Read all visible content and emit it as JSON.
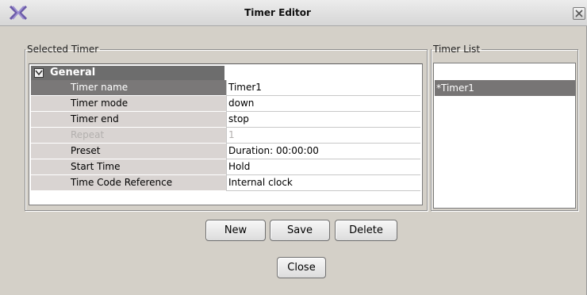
{
  "window": {
    "title": "Timer Editor"
  },
  "selected_timer": {
    "group_label": "Selected Timer",
    "category": "General",
    "properties": [
      {
        "name": "Timer name",
        "value": "Timer1"
      },
      {
        "name": "Timer mode",
        "value": "down"
      },
      {
        "name": "Timer end",
        "value": "stop"
      },
      {
        "name": "Repeat",
        "value": "1"
      },
      {
        "name": "Preset",
        "value": "Duration: 00:00:00"
      },
      {
        "name": "Start Time",
        "value": "Hold"
      },
      {
        "name": "Time Code Reference",
        "value": "Internal clock"
      }
    ],
    "selected_property": "Timer name",
    "disabled_property": "Repeat"
  },
  "timer_list": {
    "group_label": "Timer List",
    "items": [
      "*Timer1"
    ],
    "selected_item": "*Timer1"
  },
  "buttons": {
    "new": "New",
    "save": "Save",
    "delete": "Delete",
    "close": "Close"
  },
  "colors": {
    "window_bg": "#d4d0c8",
    "selection_gray": "#777575",
    "category_header": "#6d6d6d"
  },
  "icons": {
    "app_logo": "grass-valley-x-logo-icon",
    "close": "close-icon",
    "category_toggle": "checkbox-icon"
  }
}
